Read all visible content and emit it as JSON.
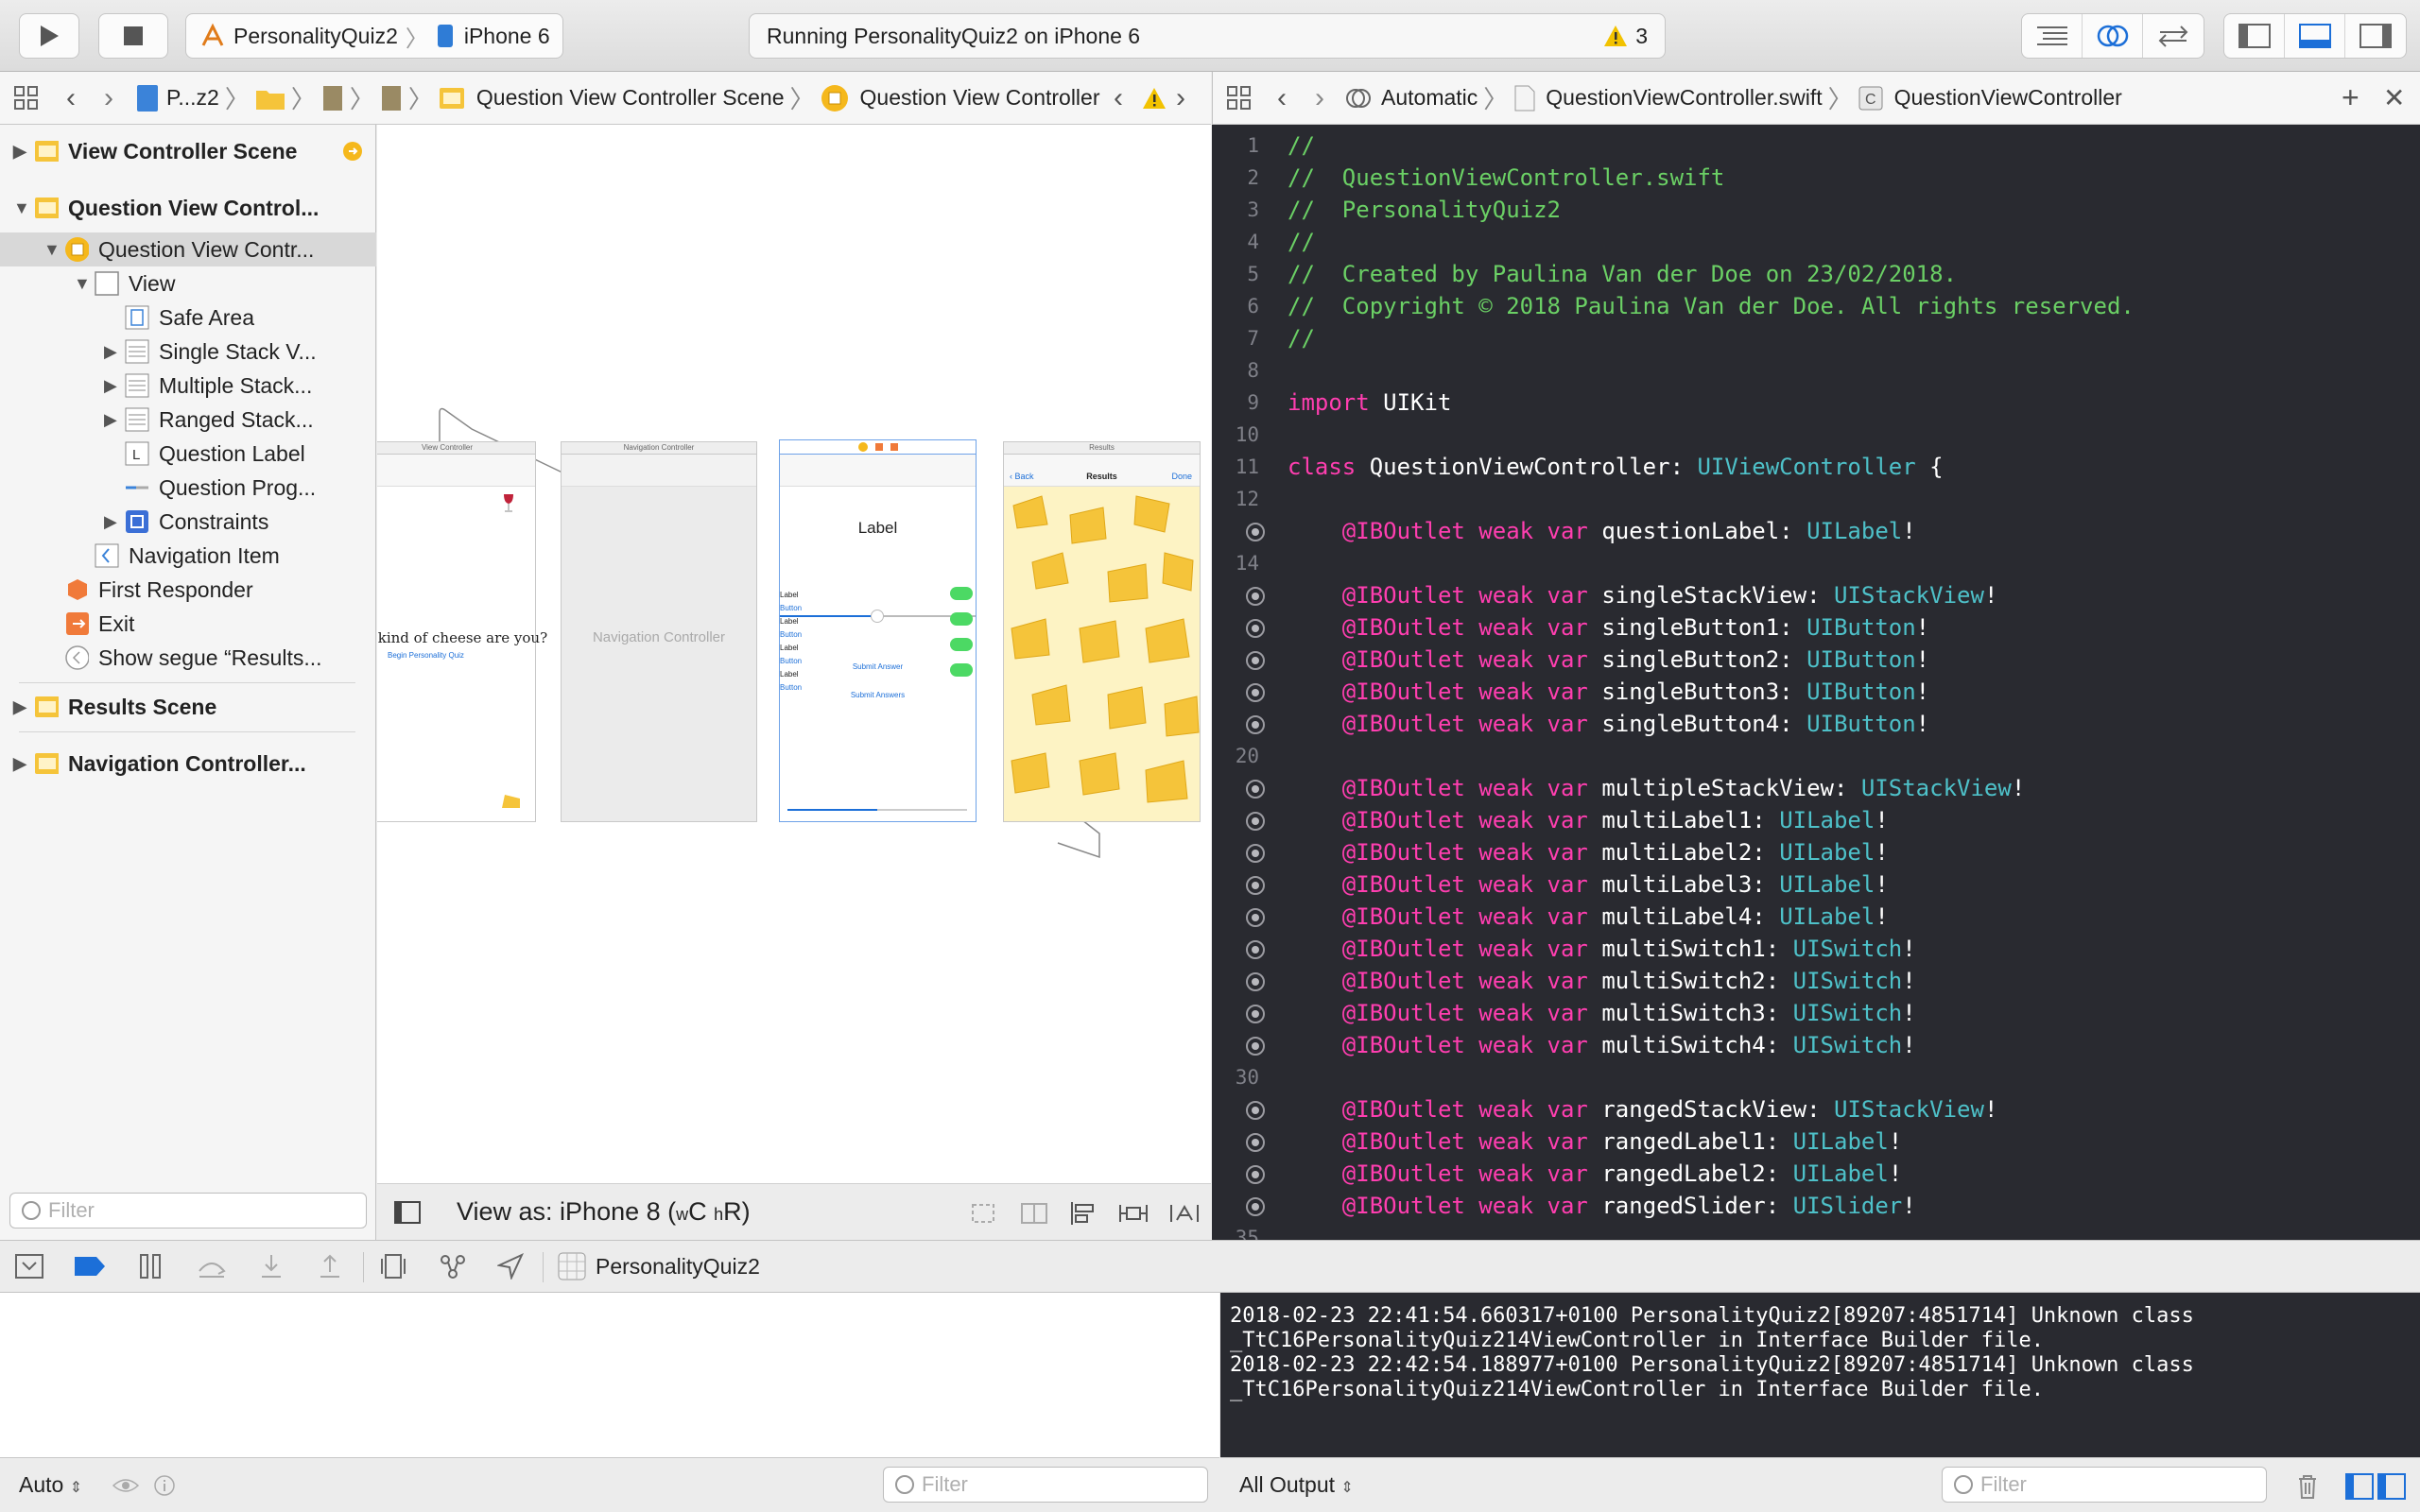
{
  "toolbar": {
    "scheme_name": "PersonalityQuiz2",
    "device_name": "iPhone 6",
    "status_text": "Running PersonalityQuiz2 on iPhone 6",
    "warning_count": "3"
  },
  "ib_jumpbar": {
    "project": "P...z2",
    "scene": "Question View Controller Scene",
    "controller": "Question View Controller"
  },
  "editor_jumpbar": {
    "mode": "Automatic",
    "file": "QuestionViewController.swift",
    "class": "QuestionViewController"
  },
  "outline": {
    "items": [
      {
        "label": "View Controller Scene"
      },
      {
        "label": "Question View Control..."
      },
      {
        "label": "Question View Contr..."
      },
      {
        "label": "View"
      },
      {
        "label": "Safe Area"
      },
      {
        "label": "Single Stack V..."
      },
      {
        "label": "Multiple Stack..."
      },
      {
        "label": "Ranged Stack..."
      },
      {
        "label": "Question Label"
      },
      {
        "label": "Question Prog..."
      },
      {
        "label": "Constraints"
      },
      {
        "label": "Navigation Item"
      },
      {
        "label": "First Responder"
      },
      {
        "label": "Exit"
      },
      {
        "label": "Show segue “Results..."
      },
      {
        "label": "Results Scene"
      },
      {
        "label": "Navigation Controller..."
      }
    ],
    "filter_placeholder": "Filter"
  },
  "canvas": {
    "view_as_prefix": "View as: iPhone 8 (",
    "size_class_w": "w",
    "size_class_w_val": "C",
    "size_class_h": "h",
    "size_class_h_val": "R",
    "view_as_suffix": ")",
    "scene1_title": "View Controller",
    "scene1_question": "at kind of cheese are you?",
    "scene1_link": "Begin Personality Quiz",
    "scene2_title": "Navigation Controller",
    "scene2_body": "Navigation Controller",
    "scene3_label": "Label",
    "scene3_rows": [
      "Label",
      "Button",
      "Label",
      "Button",
      "Label",
      "Button",
      "Label",
      "Button"
    ],
    "scene3_submit1": "Submit Answer",
    "scene3_submit2": "Submit Answers",
    "scene4_title": "Results",
    "scene4_back": "Back",
    "scene4_nav_title": "Results",
    "scene4_done": "Done"
  },
  "code": {
    "lines": [
      {
        "n": "1",
        "parts": [
          [
            "c-cm",
            "//"
          ]
        ]
      },
      {
        "n": "2",
        "parts": [
          [
            "c-cm",
            "//  QuestionViewController.swift"
          ]
        ]
      },
      {
        "n": "3",
        "parts": [
          [
            "c-cm",
            "//  PersonalityQuiz2"
          ]
        ]
      },
      {
        "n": "4",
        "parts": [
          [
            "c-cm",
            "//"
          ]
        ]
      },
      {
        "n": "5",
        "parts": [
          [
            "c-cm",
            "//  Created by Paulina Van der Doe on 23/02/2018."
          ]
        ]
      },
      {
        "n": "6",
        "parts": [
          [
            "c-cm",
            "//  Copyright © 2018 Paulina Van der Doe. All rights reserved."
          ]
        ]
      },
      {
        "n": "7",
        "parts": [
          [
            "c-cm",
            "//"
          ]
        ]
      },
      {
        "n": "8",
        "parts": []
      },
      {
        "n": "9",
        "parts": [
          [
            "c-kw",
            "import"
          ],
          [
            "",
            " UIKit"
          ]
        ]
      },
      {
        "n": "10",
        "parts": []
      },
      {
        "n": "11",
        "parts": [
          [
            "c-kw",
            "class"
          ],
          [
            "",
            " QuestionViewController: "
          ],
          [
            "c-ty",
            "UIViewController"
          ],
          [
            "",
            " {"
          ]
        ]
      },
      {
        "n": "12",
        "parts": []
      },
      {
        "n": "",
        "bp": true,
        "parts": [
          [
            "c-kw",
            "    @IBOutlet weak var"
          ],
          [
            "",
            " questionLabel: "
          ],
          [
            "c-ty",
            "UILabel"
          ],
          [
            "",
            "!"
          ]
        ]
      },
      {
        "n": "14",
        "parts": []
      },
      {
        "n": "",
        "bp": true,
        "parts": [
          [
            "c-kw",
            "    @IBOutlet weak var"
          ],
          [
            "",
            " singleStackView: "
          ],
          [
            "c-ty",
            "UIStackView"
          ],
          [
            "",
            "!"
          ]
        ]
      },
      {
        "n": "",
        "bp": true,
        "parts": [
          [
            "c-kw",
            "    @IBOutlet weak var"
          ],
          [
            "",
            " singleButton1: "
          ],
          [
            "c-ty",
            "UIButton"
          ],
          [
            "",
            "!"
          ]
        ]
      },
      {
        "n": "",
        "bp": true,
        "parts": [
          [
            "c-kw",
            "    @IBOutlet weak var"
          ],
          [
            "",
            " singleButton2: "
          ],
          [
            "c-ty",
            "UIButton"
          ],
          [
            "",
            "!"
          ]
        ]
      },
      {
        "n": "",
        "bp": true,
        "parts": [
          [
            "c-kw",
            "    @IBOutlet weak var"
          ],
          [
            "",
            " singleButton3: "
          ],
          [
            "c-ty",
            "UIButton"
          ],
          [
            "",
            "!"
          ]
        ]
      },
      {
        "n": "",
        "bp": true,
        "parts": [
          [
            "c-kw",
            "    @IBOutlet weak var"
          ],
          [
            "",
            " singleButton4: "
          ],
          [
            "c-ty",
            "UIButton"
          ],
          [
            "",
            "!"
          ]
        ]
      },
      {
        "n": "20",
        "parts": []
      },
      {
        "n": "",
        "bp": true,
        "parts": [
          [
            "c-kw",
            "    @IBOutlet weak var"
          ],
          [
            "",
            " multipleStackView: "
          ],
          [
            "c-ty",
            "UIStackView"
          ],
          [
            "",
            "!"
          ]
        ]
      },
      {
        "n": "",
        "bp": true,
        "parts": [
          [
            "c-kw",
            "    @IBOutlet weak var"
          ],
          [
            "",
            " multiLabel1: "
          ],
          [
            "c-ty",
            "UILabel"
          ],
          [
            "",
            "!"
          ]
        ]
      },
      {
        "n": "",
        "bp": true,
        "parts": [
          [
            "c-kw",
            "    @IBOutlet weak var"
          ],
          [
            "",
            " multiLabel2: "
          ],
          [
            "c-ty",
            "UILabel"
          ],
          [
            "",
            "!"
          ]
        ]
      },
      {
        "n": "",
        "bp": true,
        "parts": [
          [
            "c-kw",
            "    @IBOutlet weak var"
          ],
          [
            "",
            " multiLabel3: "
          ],
          [
            "c-ty",
            "UILabel"
          ],
          [
            "",
            "!"
          ]
        ]
      },
      {
        "n": "",
        "bp": true,
        "parts": [
          [
            "c-kw",
            "    @IBOutlet weak var"
          ],
          [
            "",
            " multiLabel4: "
          ],
          [
            "c-ty",
            "UILabel"
          ],
          [
            "",
            "!"
          ]
        ]
      },
      {
        "n": "",
        "bp": true,
        "parts": [
          [
            "c-kw",
            "    @IBOutlet weak var"
          ],
          [
            "",
            " multiSwitch1: "
          ],
          [
            "c-ty",
            "UISwitch"
          ],
          [
            "",
            "!"
          ]
        ]
      },
      {
        "n": "",
        "bp": true,
        "parts": [
          [
            "c-kw",
            "    @IBOutlet weak var"
          ],
          [
            "",
            " multiSwitch2: "
          ],
          [
            "c-ty",
            "UISwitch"
          ],
          [
            "",
            "!"
          ]
        ]
      },
      {
        "n": "",
        "bp": true,
        "parts": [
          [
            "c-kw",
            "    @IBOutlet weak var"
          ],
          [
            "",
            " multiSwitch3: "
          ],
          [
            "c-ty",
            "UISwitch"
          ],
          [
            "",
            "!"
          ]
        ]
      },
      {
        "n": "",
        "bp": true,
        "parts": [
          [
            "c-kw",
            "    @IBOutlet weak var"
          ],
          [
            "",
            " multiSwitch4: "
          ],
          [
            "c-ty",
            "UISwitch"
          ],
          [
            "",
            "!"
          ]
        ]
      },
      {
        "n": "30",
        "parts": []
      },
      {
        "n": "",
        "bp": true,
        "parts": [
          [
            "c-kw",
            "    @IBOutlet weak var"
          ],
          [
            "",
            " rangedStackView: "
          ],
          [
            "c-ty",
            "UIStackView"
          ],
          [
            "",
            "!"
          ]
        ]
      },
      {
        "n": "",
        "bp": true,
        "parts": [
          [
            "c-kw",
            "    @IBOutlet weak var"
          ],
          [
            "",
            " rangedLabel1: "
          ],
          [
            "c-ty",
            "UILabel"
          ],
          [
            "",
            "!"
          ]
        ]
      },
      {
        "n": "",
        "bp": true,
        "parts": [
          [
            "c-kw",
            "    @IBOutlet weak var"
          ],
          [
            "",
            " rangedLabel2: "
          ],
          [
            "c-ty",
            "UILabel"
          ],
          [
            "",
            "!"
          ]
        ]
      },
      {
        "n": "",
        "bp": true,
        "parts": [
          [
            "c-kw",
            "    @IBOutlet weak var"
          ],
          [
            "",
            " rangedSlider: "
          ],
          [
            "c-ty",
            "UISlider"
          ],
          [
            "",
            "!"
          ]
        ]
      },
      {
        "n": "35",
        "parts": []
      }
    ]
  },
  "debug": {
    "process": "PersonalityQuiz2",
    "console_text": "2018-02-23 22:41:54.660317+0100 PersonalityQuiz2[89207:4851714] Unknown class\n_TtC16PersonalityQuiz214ViewController in Interface Builder file.\n2018-02-23 22:42:54.188977+0100 PersonalityQuiz2[89207:4851714] Unknown class\n_TtC16PersonalityQuiz214ViewController in Interface Builder file.",
    "auto_label": "Auto",
    "output_label": "All Output",
    "filter_placeholder": "Filter"
  },
  "colors": {
    "accent": "#1c6fd8",
    "editor_bg": "#292a30",
    "comment": "#6bd065",
    "keyword": "#ff3eb0",
    "type": "#4ec1c9",
    "warning": "#f2c200"
  }
}
